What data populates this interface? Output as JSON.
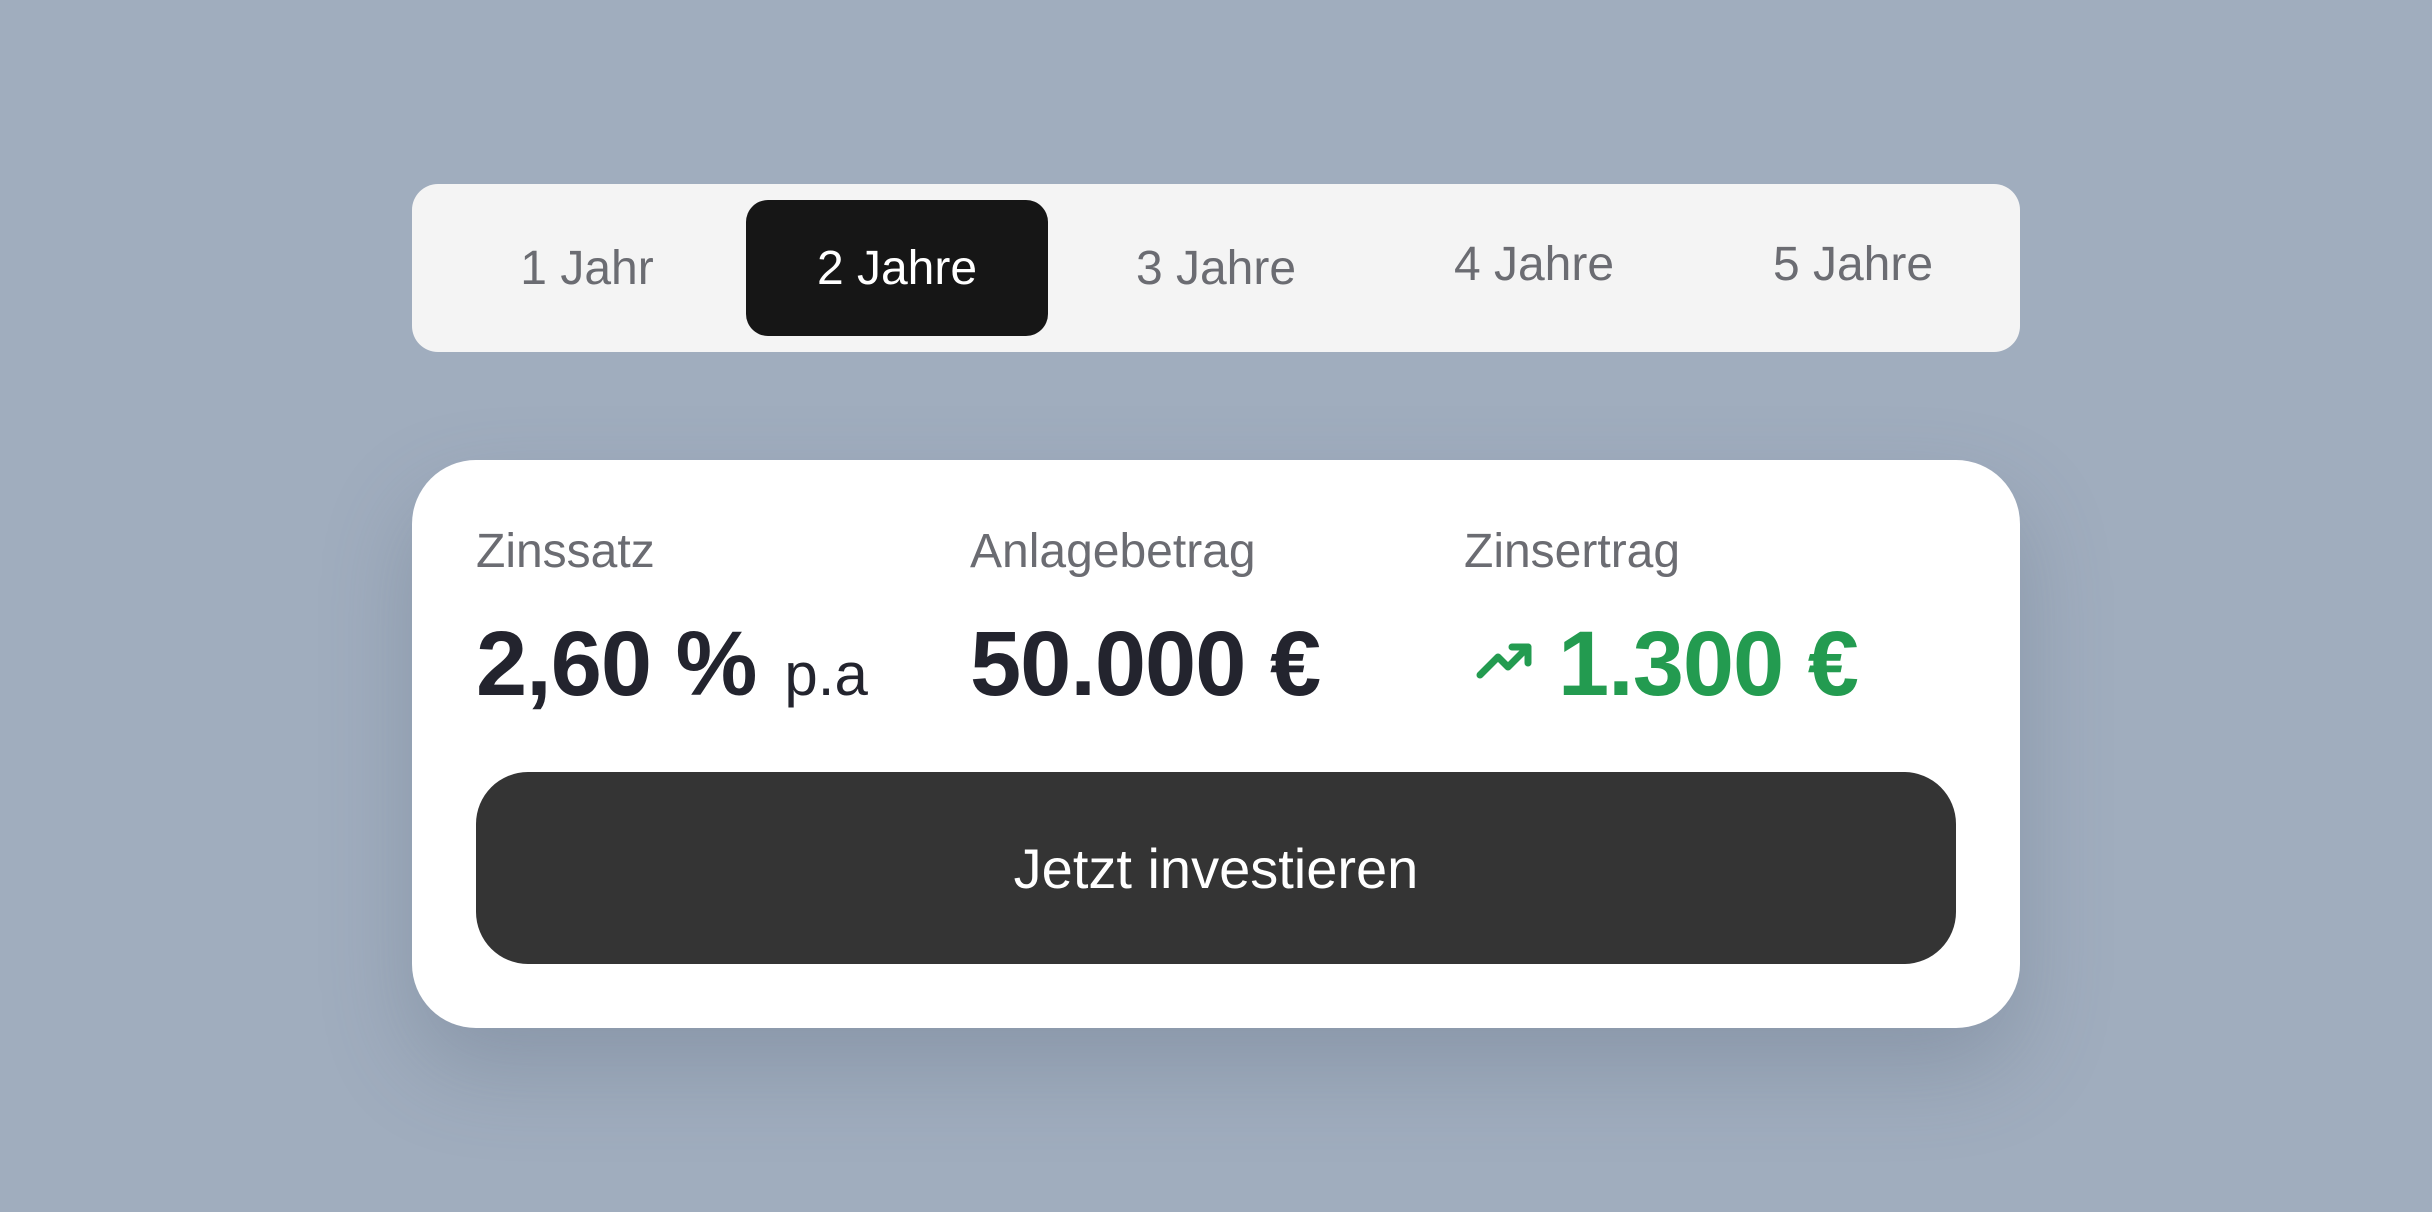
{
  "term_selector": {
    "options": [
      {
        "label": "1 Jahr"
      },
      {
        "label": "2 Jahre"
      },
      {
        "label": "3 Jahre"
      },
      {
        "label": "4 Jahre"
      },
      {
        "label": "5 Jahre"
      }
    ],
    "selected": "2 Jahre"
  },
  "card": {
    "rate": {
      "label": "Zinssatz",
      "value": "2,60 %",
      "unit": "p.a"
    },
    "amount": {
      "label": "Anlagebetrag",
      "value": "50.000 €"
    },
    "yield": {
      "label": "Zinsertrag",
      "value": "1.300 €",
      "icon": "trending-up-icon"
    },
    "button_label": "Jetzt investieren"
  },
  "colors": {
    "background": "#a0adbe",
    "selector_bg": "#f4f4f4",
    "selected_tab": "#161616",
    "card_bg": "#ffffff",
    "primary_text": "#23242e",
    "muted_text": "#6b6c72",
    "positive": "#239b50",
    "button_bg": "#343434"
  }
}
